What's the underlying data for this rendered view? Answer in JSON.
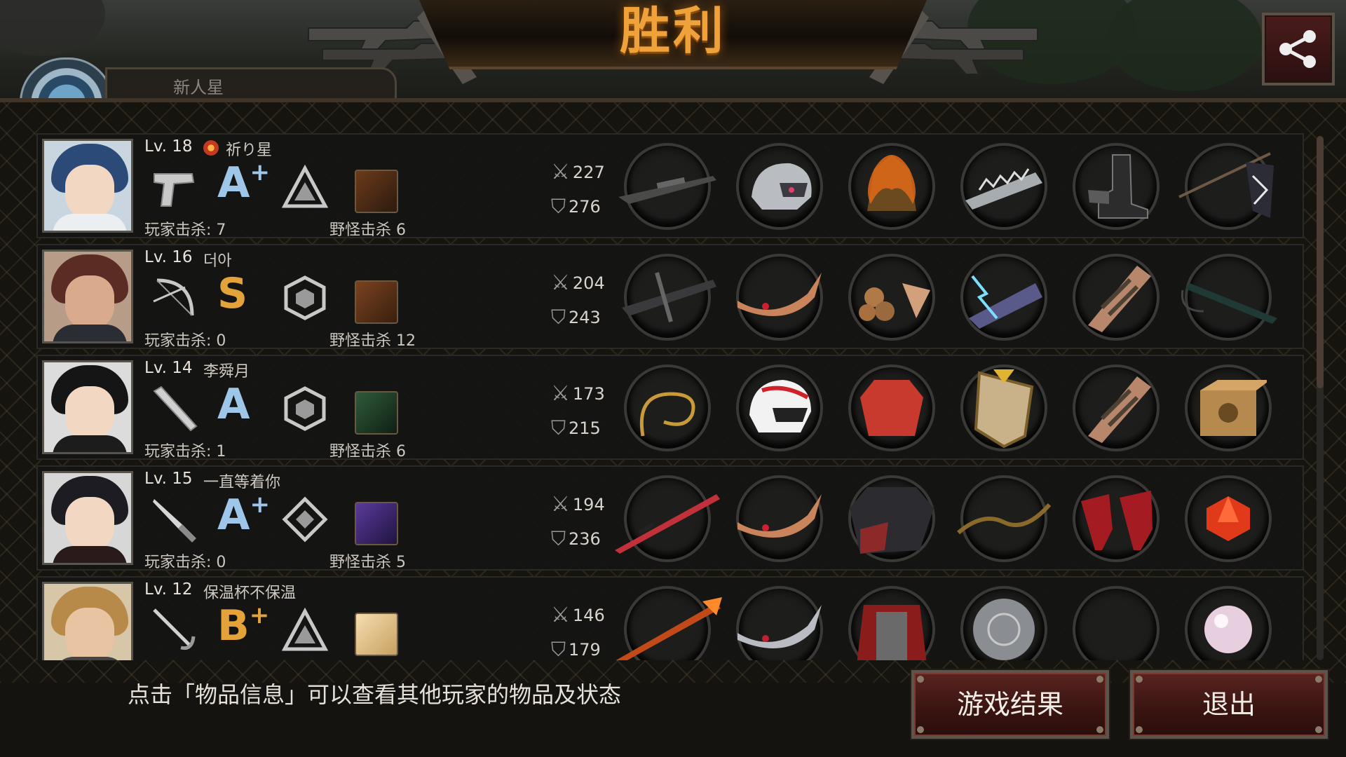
{
  "header": {
    "title": "胜利"
  },
  "emblem_partial_text": "新人星",
  "hint_text": "点击「物品信息」可以查看其他玩家的物品及状态",
  "buttons": {
    "result_label": "游戏结果",
    "exit_label": "退出"
  },
  "players": [
    {
      "level": "Lv. 18",
      "name": "祈り星",
      "has_rank_icon": true,
      "weapon_icon": "pistol-icon",
      "grade": "A",
      "grade_plus": "+",
      "grade_color": "#9ec6e8",
      "style_icon": "triangle-icon",
      "monster_icon": "claw-scratch-icon",
      "player_kills": "玩家击杀: 7",
      "monster_kills": "野怪击杀 6",
      "attack": "227",
      "defense": "276",
      "items": [
        "sniper-rifle-icon",
        "motorcycle-helmet-icon",
        "flaming-armor-icon",
        "spiked-bracer-icon",
        "spiked-boots-icon",
        "flag-spear-icon"
      ]
    },
    {
      "level": "Lv. 16",
      "name": "더아",
      "has_rank_icon": false,
      "weapon_icon": "bow-icon",
      "grade": "S",
      "grade_plus": "",
      "grade_color": "#e3a23a",
      "style_icon": "hexagon-cube-icon",
      "monster_icon": "crossed-swords-icon",
      "player_kills": "玩家击杀: 0",
      "monster_kills": "野怪击杀 12",
      "attack": "204",
      "defense": "243",
      "items": [
        "crossbow-icon",
        "winged-tiara-icon",
        "grape-armor-icon",
        "lightning-gauntlet-icon",
        "arm-guard-icon",
        "tube-icon"
      ]
    },
    {
      "level": "Lv. 14",
      "name": "李舜月",
      "has_rank_icon": false,
      "weapon_icon": "bat-icon",
      "grade": "A",
      "grade_plus": "",
      "grade_color": "#9ec6e8",
      "style_icon": "hexagon-cube-icon",
      "monster_icon": "soldier-portrait-icon",
      "player_kills": "玩家击杀: 1",
      "monster_kills": "野怪击杀 6",
      "attack": "173",
      "defense": "215",
      "items": [
        "whip-icon",
        "racing-helmet-icon",
        "red-jacket-icon",
        "ornate-shield-icon",
        "arm-guard-icon",
        "cat-box-icon"
      ]
    },
    {
      "level": "Lv. 15",
      "name": "一直等着你",
      "has_rank_icon": false,
      "weapon_icon": "dagger-icon",
      "grade": "A",
      "grade_plus": "+",
      "grade_color": "#9ec6e8",
      "style_icon": "diamond-cross-icon",
      "monster_icon": "purple-beast-icon",
      "player_kills": "玩家击杀: 0",
      "monster_kills": "野怪击杀 5",
      "attack": "194",
      "defense": "236",
      "items": [
        "katana-icon",
        "winged-tiara-icon",
        "long-coat-icon",
        "thorn-vine-icon",
        "red-heels-icon",
        "d20-dice-icon"
      ]
    },
    {
      "level": "Lv. 12",
      "name": "保温杯不保温",
      "has_rank_icon": false,
      "weapon_icon": "rapier-icon",
      "grade": "B",
      "grade_plus": "+",
      "grade_color": "#e3a23a",
      "style_icon": "triangle-icon",
      "monster_icon": "bread-icon",
      "player_kills": "",
      "monster_kills": "",
      "attack": "146",
      "defense": "179",
      "items": [
        "flame-spear-icon",
        "silver-tiara-icon",
        "red-cape-armor-icon",
        "steel-disc-icon",
        "empty-slot",
        "pearl-icon"
      ]
    }
  ]
}
